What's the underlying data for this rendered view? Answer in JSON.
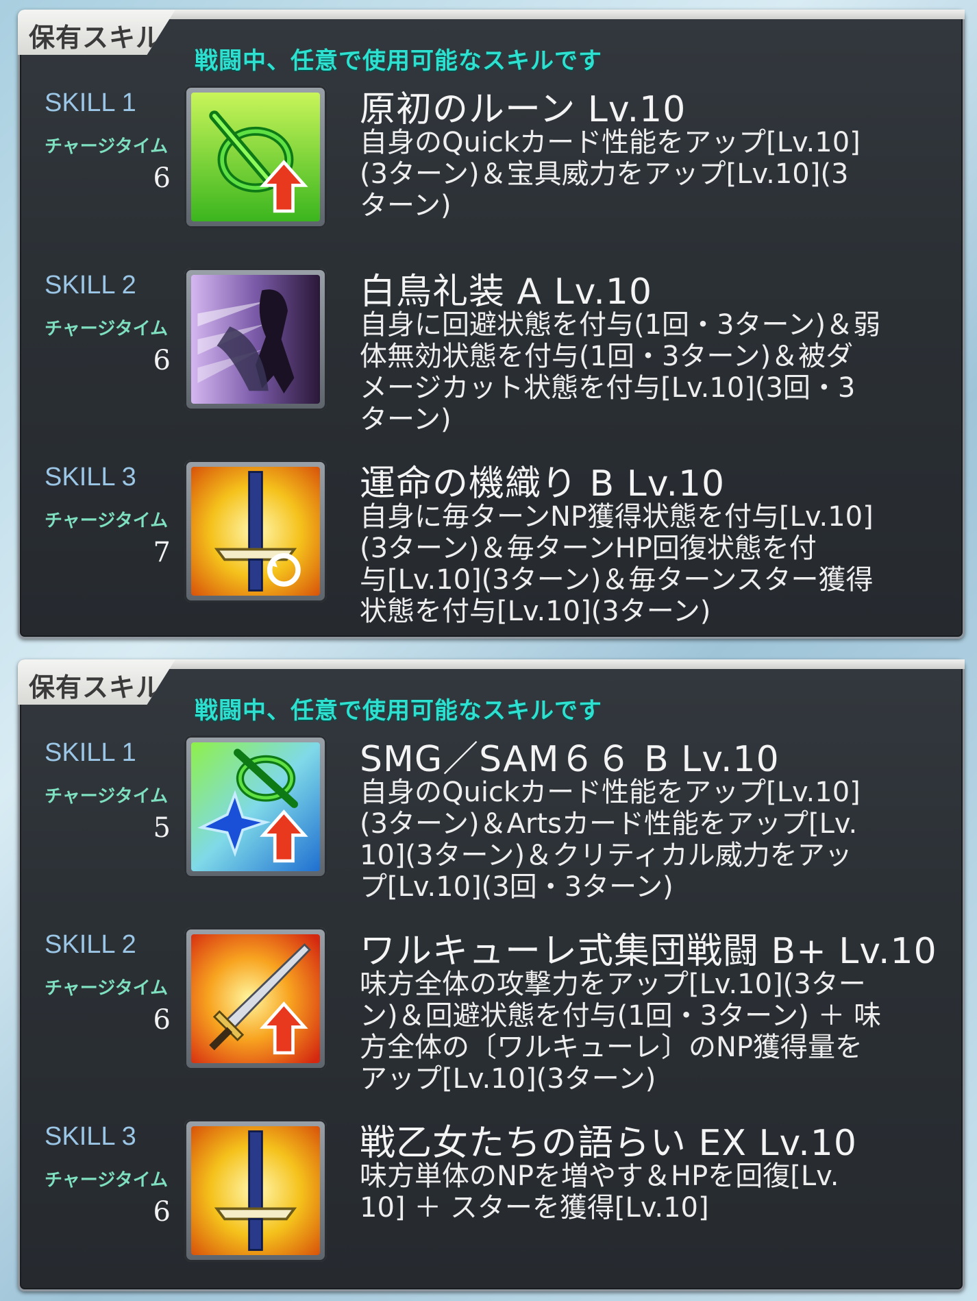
{
  "panels": [
    {
      "tab_label": "保有スキル",
      "subtitle": "戦闘中、任意で使用可能なスキルです",
      "skills": [
        {
          "number": "SKILL 1",
          "charge_label": "チャージタイム",
          "charge": "6",
          "icon": "quick-up-icon",
          "name": "原初のルーン Lv.10",
          "desc": "自身のQuickカード性能をアップ[Lv.10]\n(3ターン)＆宝具威力をアップ[Lv.10](3\nターン)"
        },
        {
          "number": "SKILL 2",
          "charge_label": "チャージタイム",
          "charge": "6",
          "icon": "evade-figure-icon",
          "name": "白鳥礼装 A Lv.10",
          "desc": "自身に回避状態を付与(1回・3ターン)＆弱\n体無効状態を付与(1回・3ターン)＆被ダ\nメージカット状態を付与[Lv.10](3回・3\nターン)"
        },
        {
          "number": "SKILL 3",
          "charge_label": "チャージタイム",
          "charge": "7",
          "icon": "sword-regen-icon",
          "name": "運命の機織り B Lv.10",
          "desc": "自身に毎ターンNP獲得状態を付与[Lv.10]\n(3ターン)＆毎ターンHP回復状態を付\n与[Lv.10](3ターン)＆毎ターンスター獲得\n状態を付与[Lv.10](3ターン)"
        }
      ]
    },
    {
      "tab_label": "保有スキル",
      "subtitle": "戦闘中、任意で使用可能なスキルです",
      "skills": [
        {
          "number": "SKILL 1",
          "charge_label": "チャージタイム",
          "charge": "5",
          "icon": "quick-arts-up-icon",
          "name": "SMG／SAM６６ B Lv.10",
          "desc": "自身のQuickカード性能をアップ[Lv.10]\n(3ターン)＆Artsカード性能をアップ[Lv.\n10](3ターン)＆クリティカル威力をアッ\nプ[Lv.10](3回・3ターン)"
        },
        {
          "number": "SKILL 2",
          "charge_label": "チャージタイム",
          "charge": "6",
          "icon": "attack-up-sword-icon",
          "name": "ワルキューレ式集団戦闘 B+ Lv.10",
          "desc": "味方全体の攻撃力をアップ[Lv.10](3ター\nン)＆回避状態を付与(1回・3ターン) ＋ 味\n方全体の〔ワルキューレ〕のNP獲得量を\nアップ[Lv.10](3ターン)"
        },
        {
          "number": "SKILL 3",
          "charge_label": "チャージタイム",
          "charge": "6",
          "icon": "sword-np-icon",
          "name": "戦乙女たちの語らい EX Lv.10",
          "desc": "味方単体のNPを増やす＆HPを回復[Lv.\n10] ＋ スターを獲得[Lv.10]"
        }
      ]
    }
  ]
}
